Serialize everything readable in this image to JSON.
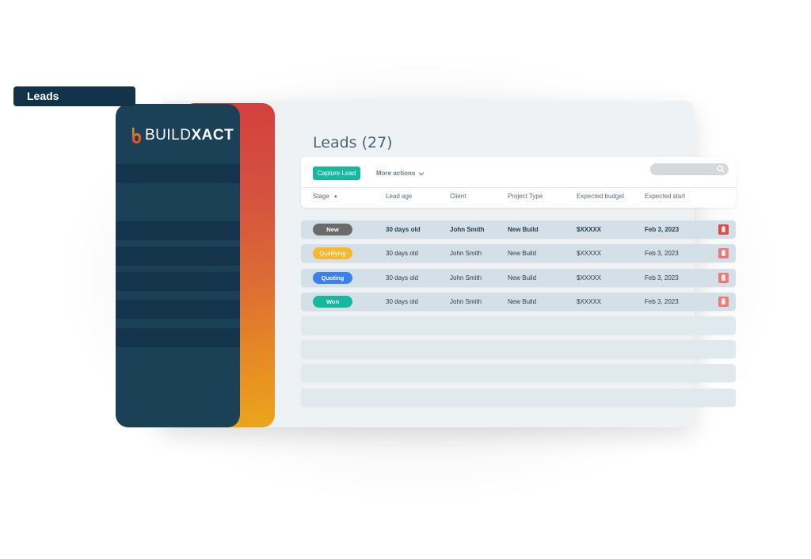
{
  "app": {
    "brand_light": "BUILD",
    "brand_bold": "XACT"
  },
  "sidebar": {
    "active_item": "Leads"
  },
  "page": {
    "title": "Leads (27)"
  },
  "toolbar": {
    "capture_lead_label": "Capture Lead",
    "more_actions_label": "More actions",
    "search_placeholder": ""
  },
  "table": {
    "columns": [
      "Stage",
      "Lead age",
      "Client",
      "Project Type",
      "Expected budget",
      "Expected start"
    ],
    "sort_column": "Stage",
    "sort_direction": "ascending",
    "rows": [
      {
        "stage": "New",
        "stage_color": "#6b6b6b",
        "lead_age": "30 days old",
        "client": "John Smith",
        "project_type": "New Build",
        "budget": "$XXXXX",
        "start": "Feb 3, 2023"
      },
      {
        "stage": "Qualifying",
        "stage_color": "#f5b82e",
        "lead_age": "30 days old",
        "client": "John Smith",
        "project_type": "New Build",
        "budget": "$XXXXX",
        "start": "Feb 3, 2023"
      },
      {
        "stage": "Quoting",
        "stage_color": "#3b7ff0",
        "lead_age": "30 days old",
        "client": "John Smith",
        "project_type": "New Build",
        "budget": "$XXXXX",
        "start": "Feb 3, 2023"
      },
      {
        "stage": "Won",
        "stage_color": "#16b99e",
        "lead_age": "30 days old",
        "client": "John Smith",
        "project_type": "New Build",
        "budget": "$XXXXX",
        "start": "Feb 3, 2023"
      }
    ],
    "empty_rows": 4
  },
  "colors": {
    "sidebar": "#1b4157",
    "accent_primary": "#18b7a0",
    "delete": "#ee6a6a",
    "delete_active": "#e64a3c"
  }
}
